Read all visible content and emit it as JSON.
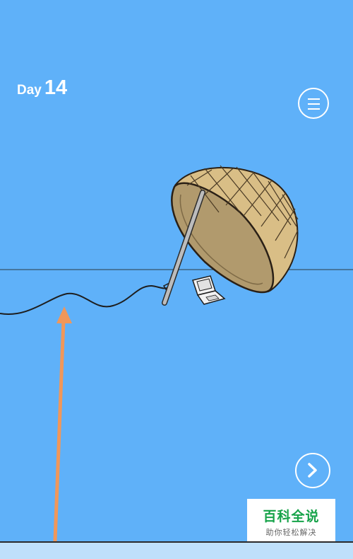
{
  "hud": {
    "day_label": "Day",
    "day_number": "14"
  },
  "buttons": {
    "menu_icon": "hamburger-menu-icon",
    "next_icon": "chevron-right-icon"
  },
  "watermark": {
    "title": "百科全说",
    "subtitle": "助你轻松解决"
  },
  "colors": {
    "sky": "#5fb1f9",
    "ground": "#bfe0fb",
    "basket": "#d9be86",
    "arrow": "#f0975a"
  }
}
